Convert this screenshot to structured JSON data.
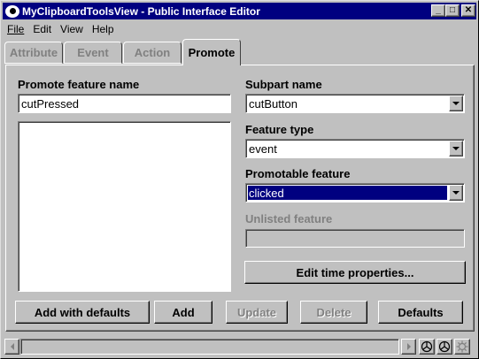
{
  "window": {
    "title": "MyClipboardToolsView - Public Interface Editor",
    "minimize_glyph": "_",
    "maximize_glyph": "□",
    "close_glyph": "✕"
  },
  "menu": {
    "file": "File",
    "edit": "Edit",
    "view": "View",
    "help": "Help"
  },
  "tabs": {
    "attribute": "Attribute",
    "event": "Event",
    "action": "Action",
    "promote": "Promote",
    "active": "Promote"
  },
  "form": {
    "promote_feature_name_label": "Promote feature name",
    "promote_feature_name_value": "cutPressed",
    "subpart_name_label": "Subpart name",
    "subpart_name_value": "cutButton",
    "feature_type_label": "Feature type",
    "feature_type_value": "event",
    "promotable_feature_label": "Promotable feature",
    "promotable_feature_value": "clicked",
    "unlisted_feature_label": "Unlisted feature",
    "unlisted_feature_value": "",
    "edit_time_properties_label": "Edit time properties...",
    "promoted_features_list": []
  },
  "buttons": {
    "add_with_defaults": "Add with defaults",
    "add": "Add",
    "update": "Update",
    "delete": "Delete",
    "defaults": "Defaults"
  },
  "statusbar": {
    "icons": [
      "tool-icon",
      "tool-icon",
      "gear-icon"
    ]
  },
  "colors": {
    "titlebar": "#000080",
    "face": "#c0c0c0",
    "selection": "#000080"
  }
}
